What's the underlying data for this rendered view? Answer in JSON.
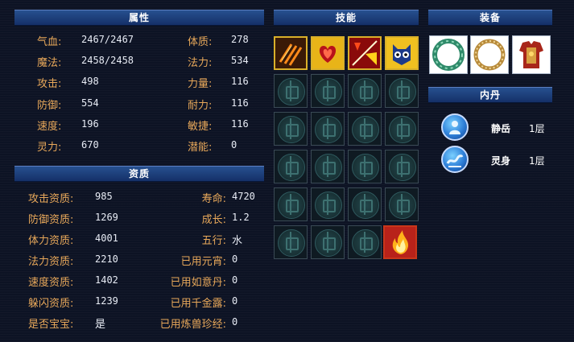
{
  "panels": {
    "attributes_title": "属性",
    "aptitude_title": "资质",
    "skills_title": "技能",
    "equipment_title": "装备",
    "neidan_title": "内丹"
  },
  "attributes": {
    "left": [
      {
        "label": "气血:",
        "value": "2467/2467"
      },
      {
        "label": "魔法:",
        "value": "2458/2458"
      },
      {
        "label": "攻击:",
        "value": "498"
      },
      {
        "label": "防御:",
        "value": "554"
      },
      {
        "label": "速度:",
        "value": "196"
      },
      {
        "label": "灵力:",
        "value": "670"
      }
    ],
    "right": [
      {
        "label": "体质:",
        "value": "278"
      },
      {
        "label": "法力:",
        "value": "534"
      },
      {
        "label": "力量:",
        "value": "116"
      },
      {
        "label": "耐力:",
        "value": "116"
      },
      {
        "label": "敏捷:",
        "value": "116"
      },
      {
        "label": "潜能:",
        "value": "0"
      }
    ]
  },
  "aptitude": {
    "left": [
      {
        "label": "攻击资质:",
        "value": "985"
      },
      {
        "label": "防御资质:",
        "value": "1269"
      },
      {
        "label": "体力资质:",
        "value": "4001"
      },
      {
        "label": "法力资质:",
        "value": "2210"
      },
      {
        "label": "速度资质:",
        "value": "1402"
      },
      {
        "label": "躲闪资质:",
        "value": "1239"
      },
      {
        "label": "是否宝宝:",
        "value": "是"
      }
    ],
    "right": [
      {
        "label": "寿命:",
        "value": "4720"
      },
      {
        "label": "成长:",
        "value": "1.2"
      },
      {
        "label": "五行:",
        "value": "水"
      },
      {
        "label": "已用元宵:",
        "value": "0"
      },
      {
        "label": "已用如意丹:",
        "value": "0"
      },
      {
        "label": "已用千金露:",
        "value": "0"
      },
      {
        "label": "已用炼兽珍经:",
        "value": "0"
      }
    ]
  },
  "skills": {
    "icons": [
      "claw-strike-icon",
      "heart-flame-icon",
      "lightning-fire-icon",
      "owl-mask-icon",
      "fire-icon"
    ],
    "empty_slot_icon": "empty-emblem-icon"
  },
  "equipment": {
    "icons": [
      "jade-ring-icon",
      "gold-necklace-icon",
      "red-armor-icon"
    ]
  },
  "neidan": [
    {
      "name": "静岳",
      "level": "1层",
      "icon": "blue-orb-figure-icon"
    },
    {
      "name": "灵身",
      "level": "1层",
      "icon": "blue-orb-wave-icon"
    }
  ],
  "colors": {
    "background": "#0d1324",
    "header": "#1e3f7e",
    "label": "#e8a85a",
    "value": "#e8ecf5",
    "skill_border": "#d9b02a"
  }
}
